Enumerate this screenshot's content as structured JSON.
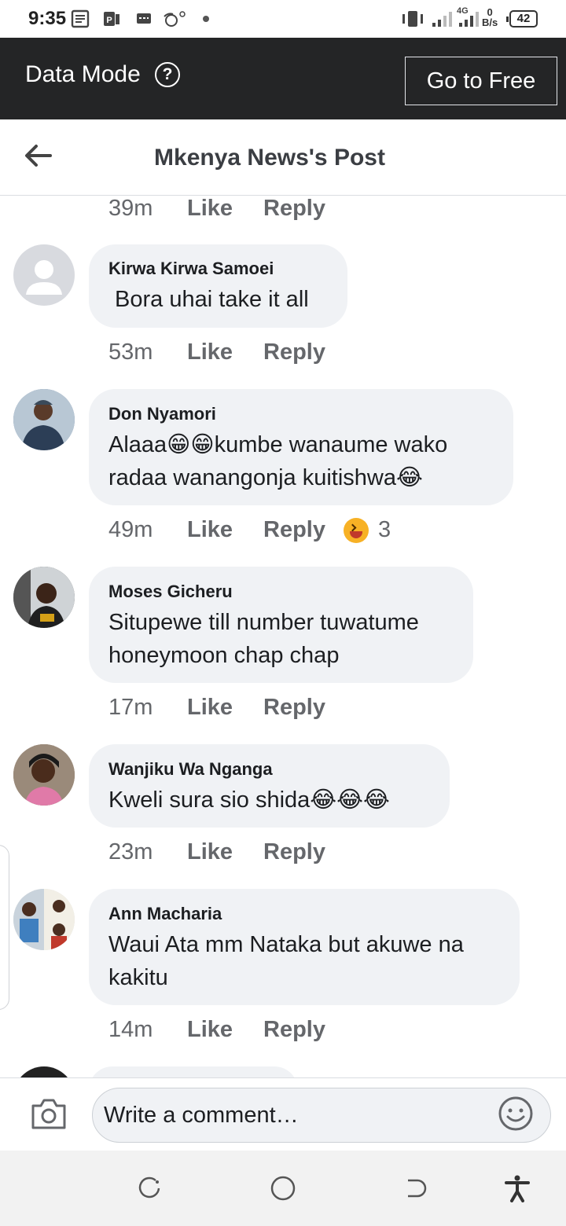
{
  "status_bar": {
    "time": "9:35",
    "network": "4G",
    "speed_value": "0",
    "speed_unit": "B/s",
    "battery": "42"
  },
  "data_mode": {
    "label": "Data Mode",
    "help_icon": "?",
    "button": "Go to Free"
  },
  "header": {
    "title": "Mkenya News's Post",
    "back_icon": "arrow-left-icon"
  },
  "comments": {
    "top_meta": {
      "time": "39m",
      "like": "Like",
      "reply": "Reply"
    },
    "items": [
      {
        "name": "Kirwa Kirwa Samoei",
        "text": " Bora uhai take it all",
        "time": "53m",
        "like": "Like",
        "reply": "Reply"
      },
      {
        "name": "Don Nyamori",
        "text": "Alaaa😁😁kumbe wanaume wako radaa wanangonja kuitishwa😂",
        "time": "49m",
        "like": "Like",
        "reply": "Reply",
        "reaction_icon": "laughing-face-icon",
        "reaction_count": "3"
      },
      {
        "name": "Moses Gicheru",
        "text": "Situpewe till number tuwatume honeymoon chap chap",
        "time": "17m",
        "like": "Like",
        "reply": "Reply"
      },
      {
        "name": "Wanjiku Wa Nganga",
        "text": "Kweli sura sio shida😂😂😂",
        "time": "23m",
        "like": "Like",
        "reply": "Reply"
      },
      {
        "name": "Ann Macharia",
        "text": "Waui Ata mm Nataka but akuwe na kakitu",
        "time": "14m",
        "like": "Like",
        "reply": "Reply"
      }
    ]
  },
  "composer": {
    "placeholder": "Write a comment…",
    "camera_icon": "camera-icon",
    "emoji_icon": "smile-icon"
  },
  "colors": {
    "data_bar_bg": "#242526",
    "bubble_bg": "#f0f2f5",
    "meta_text": "#65676b"
  }
}
